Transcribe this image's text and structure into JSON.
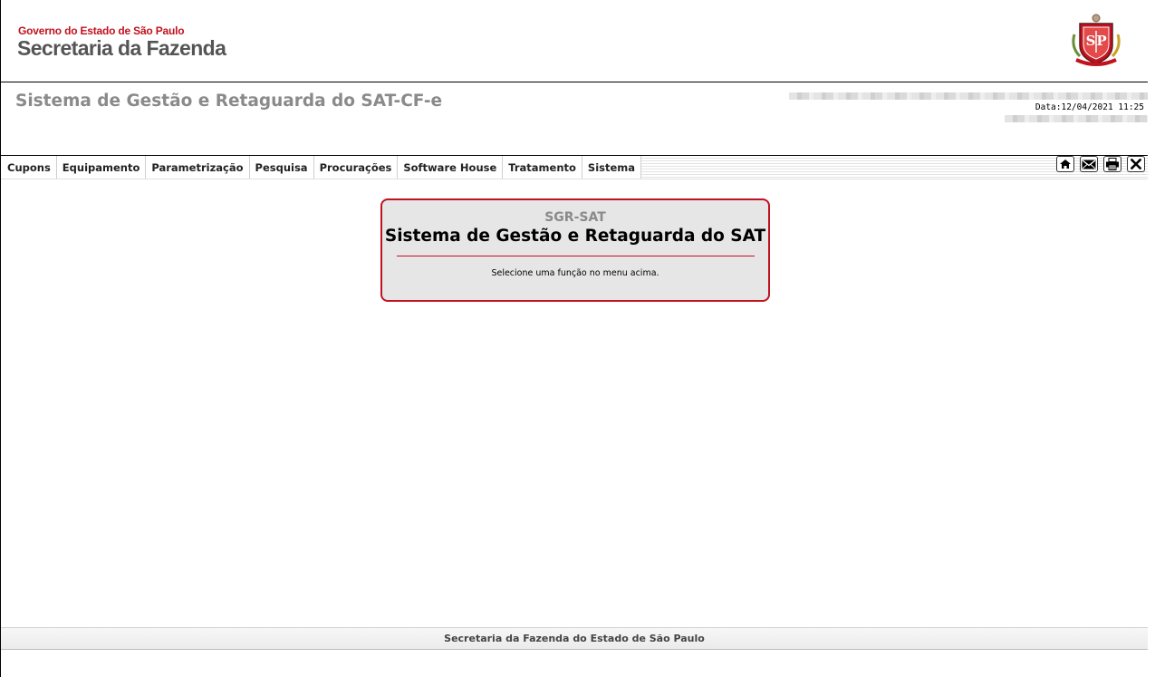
{
  "header": {
    "government": "Governo do Estado de São Paulo",
    "secretariat": "Secretaria da Fazenda",
    "crest_icon": "sp-state-coat-of-arms-icon"
  },
  "system": {
    "title": "Sistema de Gestão e Retaguarda do SAT-CF-e",
    "date_label": "Data:",
    "date_value": "12/04/2021 11:25"
  },
  "menu": {
    "items": [
      {
        "label": "Cupons"
      },
      {
        "label": "Equipamento"
      },
      {
        "label": "Parametrização"
      },
      {
        "label": "Pesquisa"
      },
      {
        "label": "Procurações"
      },
      {
        "label": "Software House"
      },
      {
        "label": "Tratamento"
      },
      {
        "label": "Sistema"
      }
    ],
    "tools": [
      "home-icon",
      "mail-icon",
      "print-icon",
      "close-icon"
    ]
  },
  "welcome": {
    "abbr": "SGR-SAT",
    "title": "Sistema de Gestão e Retaguarda do SAT",
    "message": "Selecione uma função no menu acima."
  },
  "footer": {
    "text": "Secretaria da Fazenda do Estado de São Paulo"
  },
  "colors": {
    "brand_red": "#c1121f",
    "gray_title": "#8a8a8a",
    "box_bg": "#e6e6e6"
  }
}
